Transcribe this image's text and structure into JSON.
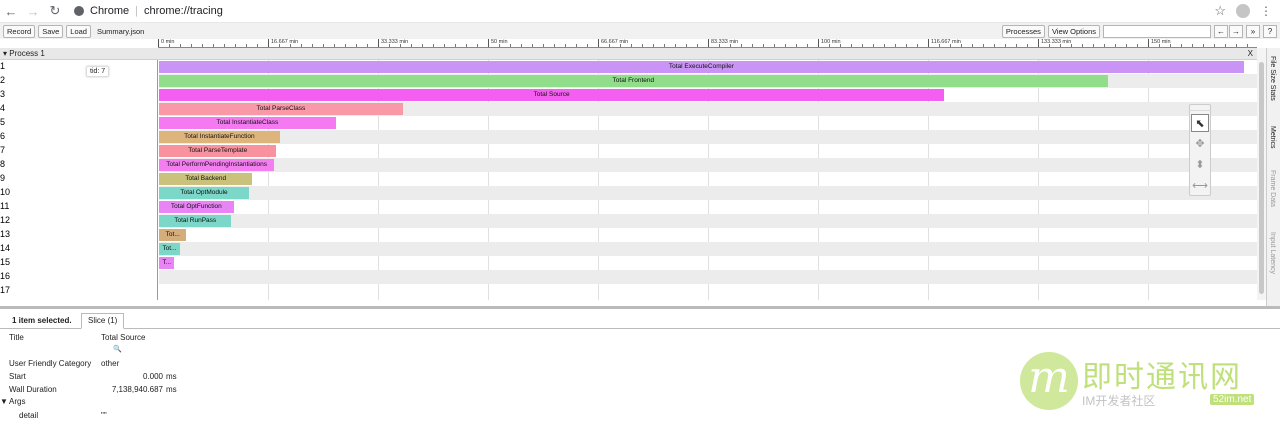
{
  "browser": {
    "site_name": "Chrome",
    "url": "chrome://tracing"
  },
  "toolbar": {
    "record_label": "Record",
    "save_label": "Save",
    "load_label": "Load",
    "file_name": "Summary.json",
    "processes_label": "Processes",
    "view_options_label": "View Options",
    "search_value": "",
    "prev_label": "←",
    "next_label": "→",
    "more_label": "»",
    "help_label": "?"
  },
  "ruler": {
    "ticks": [
      "0 min",
      "16.667 min",
      "33.333 min",
      "50 min",
      "66.667 min",
      "83.333 min",
      "100 min",
      "116.667 min",
      "133.333 min",
      "150 min"
    ]
  },
  "process": {
    "title": "Process 1",
    "close_label": "X"
  },
  "tid_tooltip": "tid: 7",
  "tracks": [
    {
      "label": "1",
      "slices": [
        {
          "name": "Total ExecuteCompiler",
          "start": 0.0,
          "end": 0.988,
          "color": "#c994f5"
        }
      ]
    },
    {
      "label": "2",
      "slices": [
        {
          "name": "Total Frontend",
          "start": 0.0,
          "end": 0.864,
          "color": "#90dd8a"
        }
      ]
    },
    {
      "label": "3",
      "slices": [
        {
          "name": "Total Source",
          "start": 0.0,
          "end": 0.715,
          "color": "#f45ff2"
        }
      ]
    },
    {
      "label": "4",
      "slices": [
        {
          "name": "Total ParseClass",
          "start": 0.0,
          "end": 0.222,
          "color": "#f999a8"
        }
      ]
    },
    {
      "label": "5",
      "slices": [
        {
          "name": "Total InstantiateClass",
          "start": 0.0,
          "end": 0.161,
          "color": "#f57af2"
        }
      ]
    },
    {
      "label": "6",
      "slices": [
        {
          "name": "Total InstantiateFunction",
          "start": 0.0,
          "end": 0.11,
          "color": "#ddb57c"
        }
      ]
    },
    {
      "label": "7",
      "slices": [
        {
          "name": "Total ParseTemplate",
          "start": 0.0,
          "end": 0.107,
          "color": "#f7929e"
        }
      ]
    },
    {
      "label": "8",
      "slices": [
        {
          "name": "Total PerformPendingInstantiations",
          "start": 0.0,
          "end": 0.105,
          "color": "#f47ef0"
        }
      ]
    },
    {
      "label": "9",
      "slices": [
        {
          "name": "Total Backend",
          "start": 0.0,
          "end": 0.085,
          "color": "#c9c17c"
        }
      ]
    },
    {
      "label": "10",
      "slices": [
        {
          "name": "Total OptModule",
          "start": 0.0,
          "end": 0.082,
          "color": "#7bd7c7"
        }
      ]
    },
    {
      "label": "11",
      "slices": [
        {
          "name": "Total OptFunction",
          "start": 0.0,
          "end": 0.068,
          "color": "#e884f5"
        }
      ]
    },
    {
      "label": "12",
      "slices": [
        {
          "name": "Total RunPass",
          "start": 0.0,
          "end": 0.066,
          "color": "#7bd7c7"
        }
      ]
    },
    {
      "label": "13",
      "slices": [
        {
          "name": "Tot...",
          "start": 0.0,
          "end": 0.025,
          "color": "#d3ad7a"
        }
      ]
    },
    {
      "label": "14",
      "slices": [
        {
          "name": "Tot...",
          "start": 0.0,
          "end": 0.019,
          "color": "#7bd7c7"
        }
      ]
    },
    {
      "label": "15",
      "slices": [
        {
          "name": "T...",
          "start": 0.0,
          "end": 0.014,
          "color": "#e884f5"
        }
      ]
    },
    {
      "label": "16",
      "slices": []
    },
    {
      "label": "17",
      "slices": []
    }
  ],
  "side_tabs": [
    "File Size Stats",
    "Metrics",
    "Frame Data",
    "Input Latency"
  ],
  "tools": [
    {
      "name": "selection-tool-icon",
      "glyph": "⬉",
      "active": true
    },
    {
      "name": "pan-tool-icon",
      "glyph": "✥",
      "active": false
    },
    {
      "name": "zoom-tool-icon",
      "glyph": "⬍",
      "active": false
    },
    {
      "name": "timing-tool-icon",
      "glyph": "⟷",
      "active": false
    }
  ],
  "analysis": {
    "selection_text": "1 item selected.",
    "tab_label": "Slice (1)",
    "title_key": "Title",
    "title_value": "Total Source",
    "category_key": "User Friendly Category",
    "category_value": "other",
    "start_key": "Start",
    "start_value": "0.000",
    "start_unit": "ms",
    "duration_key": "Wall Duration",
    "duration_value": "7,138,940.687",
    "duration_unit": "ms",
    "args_key": "Args",
    "detail_key": "detail",
    "detail_value": "\"\""
  },
  "watermark": {
    "logo_letter": "m",
    "title": "即时通讯网",
    "subtitle": "IM开发者社区",
    "badge": "52im.net"
  }
}
